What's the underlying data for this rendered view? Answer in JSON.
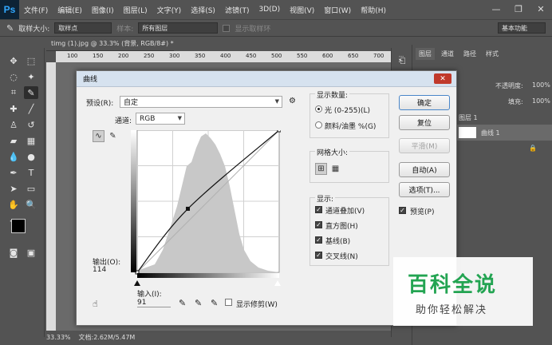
{
  "app": {
    "logo": "Ps",
    "menu": [
      "文件(F)",
      "编辑(E)",
      "图像(I)",
      "图层(L)",
      "文字(Y)",
      "选择(S)",
      "滤镜(T)",
      "3D(D)",
      "视图(V)",
      "窗口(W)",
      "帮助(H)"
    ],
    "window_controls": {
      "minimize": "—",
      "restore": "❐",
      "close": "✕"
    }
  },
  "options_bar": {
    "sample_size_label": "取样大小:",
    "sample_size_value": "取样点",
    "sample_label": "样本:",
    "sample_value": "所有图层",
    "show_ring_label": "显示取样环",
    "workspace": "基本功能"
  },
  "document": {
    "tab_title": "timg (1).jpg @ 33.3% (背景, RGB/8#) *",
    "ruler_marks": [
      "100",
      "150",
      "200",
      "250",
      "300",
      "350",
      "400",
      "450",
      "500",
      "550",
      "600",
      "650",
      "700"
    ],
    "zoom": "33.33%",
    "doc_size": "文档:2.62M/5.47M"
  },
  "right_panel": {
    "tabs": [
      "图层",
      "通道",
      "路径",
      "样式"
    ],
    "opacity_label": "不透明度:",
    "opacity_value": "100%",
    "fill_label": "填充:",
    "fill_value": "100%",
    "layer_group": "图层 1",
    "layer_name": "曲线 1"
  },
  "dialog": {
    "title": "曲线",
    "close": "✕",
    "preset_label": "预设(R):",
    "preset_value": "自定",
    "channel_label": "通道:",
    "channel_value": "RGB",
    "output_label": "输出(O):",
    "output_value": "114",
    "input_label": "输入(I):",
    "input_value": "91",
    "show_clipping": "显示修剪(W)",
    "display_amount": {
      "title": "显示数量:",
      "light": "光 (0-255)(L)",
      "pigment": "颜料/油墨 %(G)",
      "selected": "light"
    },
    "grid_size": {
      "title": "网格大小:"
    },
    "display": {
      "title": "显示:",
      "channel_overlay": "通道叠加(V)",
      "histogram": "直方图(H)",
      "baseline": "基线(B)",
      "intersection": "交叉线(N)"
    },
    "buttons": {
      "ok": "确定",
      "reset": "复位",
      "smooth": "平滑(M)",
      "auto": "自动(A)",
      "options": "选项(T)..."
    },
    "preview_label": "预览(P)",
    "curve_points": [
      [
        0,
        0
      ],
      [
        91,
        114
      ],
      [
        255,
        255
      ]
    ]
  },
  "watermark": {
    "title": "百科全说",
    "subtitle": "助你轻松解决"
  },
  "colors": {
    "ui_dark": "#535353",
    "dialog_bg": "#f0f0f0",
    "watermark_green": "#23a452",
    "ps_logo": "#31a8ff"
  }
}
